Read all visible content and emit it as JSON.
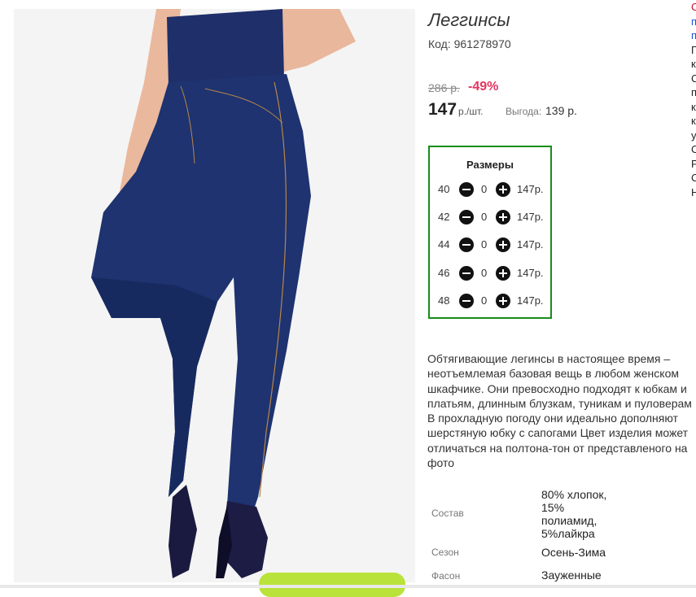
{
  "product": {
    "title": "Леггинсы",
    "code": "Код: 961278970",
    "old_price": "286 р.",
    "discount": "-49%",
    "price": "147",
    "price_unit": "р./шт.",
    "savings_label": "Выгода:",
    "savings_value": "139 р.",
    "image_icon": "leggings-photo"
  },
  "sizes": {
    "title": "Размеры",
    "rows": [
      {
        "size": "40",
        "qty": "0",
        "price": "147р."
      },
      {
        "size": "42",
        "qty": "0",
        "price": "147р."
      },
      {
        "size": "44",
        "qty": "0",
        "price": "147р."
      },
      {
        "size": "46",
        "qty": "0",
        "price": "147р."
      },
      {
        "size": "48",
        "qty": "0",
        "price": "147р."
      }
    ]
  },
  "description": [
    "Обтягивающие легинсы в настоящее время –",
    "неотъемлемая базовая вещь в любом женском",
    "шкафчике. Они превосходно подходят к юбкам и",
    "платьям, длинным блузкам, туникам и пуловерам",
    "В прохладную погоду они идеально дополняют",
    "шерстяную юбку с сапогами Цвет изделия может",
    "отличаться на полтона-тон от представленого на",
    "фото"
  ],
  "specs": [
    {
      "label": "Состав",
      "value": [
        "80% хлопок,",
        "15%",
        "полиамид,",
        "5%лайкра"
      ]
    },
    {
      "label": "Сезон",
      "value": [
        "Осень-Зима"
      ]
    },
    {
      "label": "Фасон",
      "value": [
        "Зауженные"
      ]
    }
  ],
  "right_edge_letters": [
    "С",
    "п",
    "п",
    "П",
    "к",
    "С",
    "п",
    "к",
    "к",
    "у",
    "С",
    "Р",
    "С",
    "Н"
  ],
  "colors": {
    "discount": "#e2355f",
    "sizes_border": "#1a8c1a",
    "buy_button": "#b9e23a"
  }
}
